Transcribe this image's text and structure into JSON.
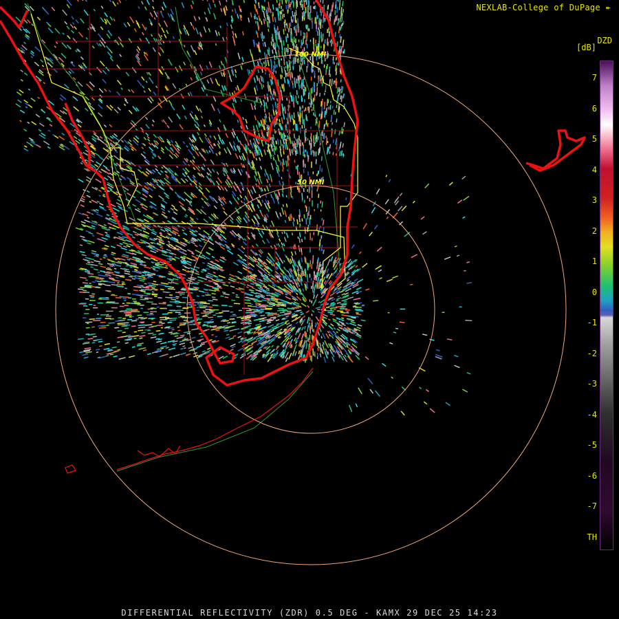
{
  "header": {
    "credit": "NEXLAB-College of DuPage"
  },
  "footer": {
    "caption": "DIFFERENTIAL REFLECTIVITY (ZDR) 0.5 DEG - KAMX 29 DEC 25 14:23"
  },
  "radar": {
    "range_rings": [
      {
        "label": "50 NMI"
      },
      {
        "label": "100 NMI"
      }
    ]
  },
  "legend": {
    "product": "DZD",
    "unit": "[dB]",
    "ticks": [
      "7",
      "6",
      "5",
      "4",
      "3",
      "2",
      "1",
      "0",
      "-1",
      "-2",
      "-3",
      "-4",
      "-5",
      "-6",
      "-7",
      "TH"
    ]
  },
  "colors": {
    "coast": "#ee1111",
    "state_border": "#ffff33",
    "county_lines": "#aa1111",
    "range_ring": "#f0a878",
    "label": "#e6e600",
    "colorbar_border": "#6b2a7b"
  }
}
